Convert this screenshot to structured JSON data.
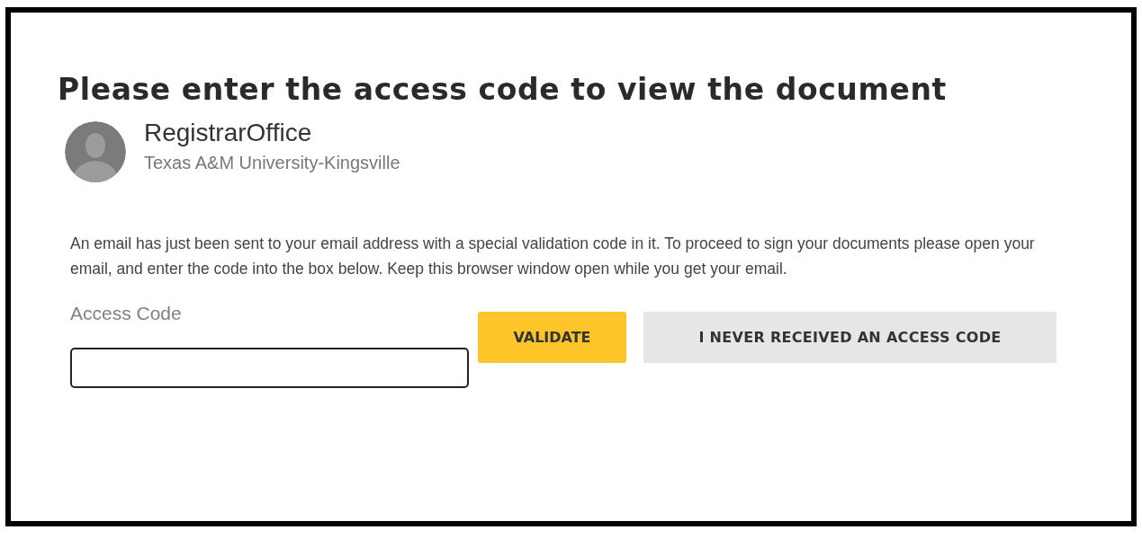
{
  "title": "Please enter the access code to view the document",
  "sender": {
    "name": "RegistrarOffice",
    "organization": "Texas A&M University-Kingsville"
  },
  "message": "An email has just been sent to your email address with a special validation code in it. To proceed to sign your documents please open your email, and enter the code into the box below. Keep this browser window open while you get your email.",
  "access_code": {
    "label": "Access Code"
  },
  "buttons": [
    {
      "label": "VALIDATE",
      "kind": "primary"
    },
    {
      "label": "I NEVER RECEIVED AN ACCESS CODE",
      "kind": "secondary"
    }
  ]
}
